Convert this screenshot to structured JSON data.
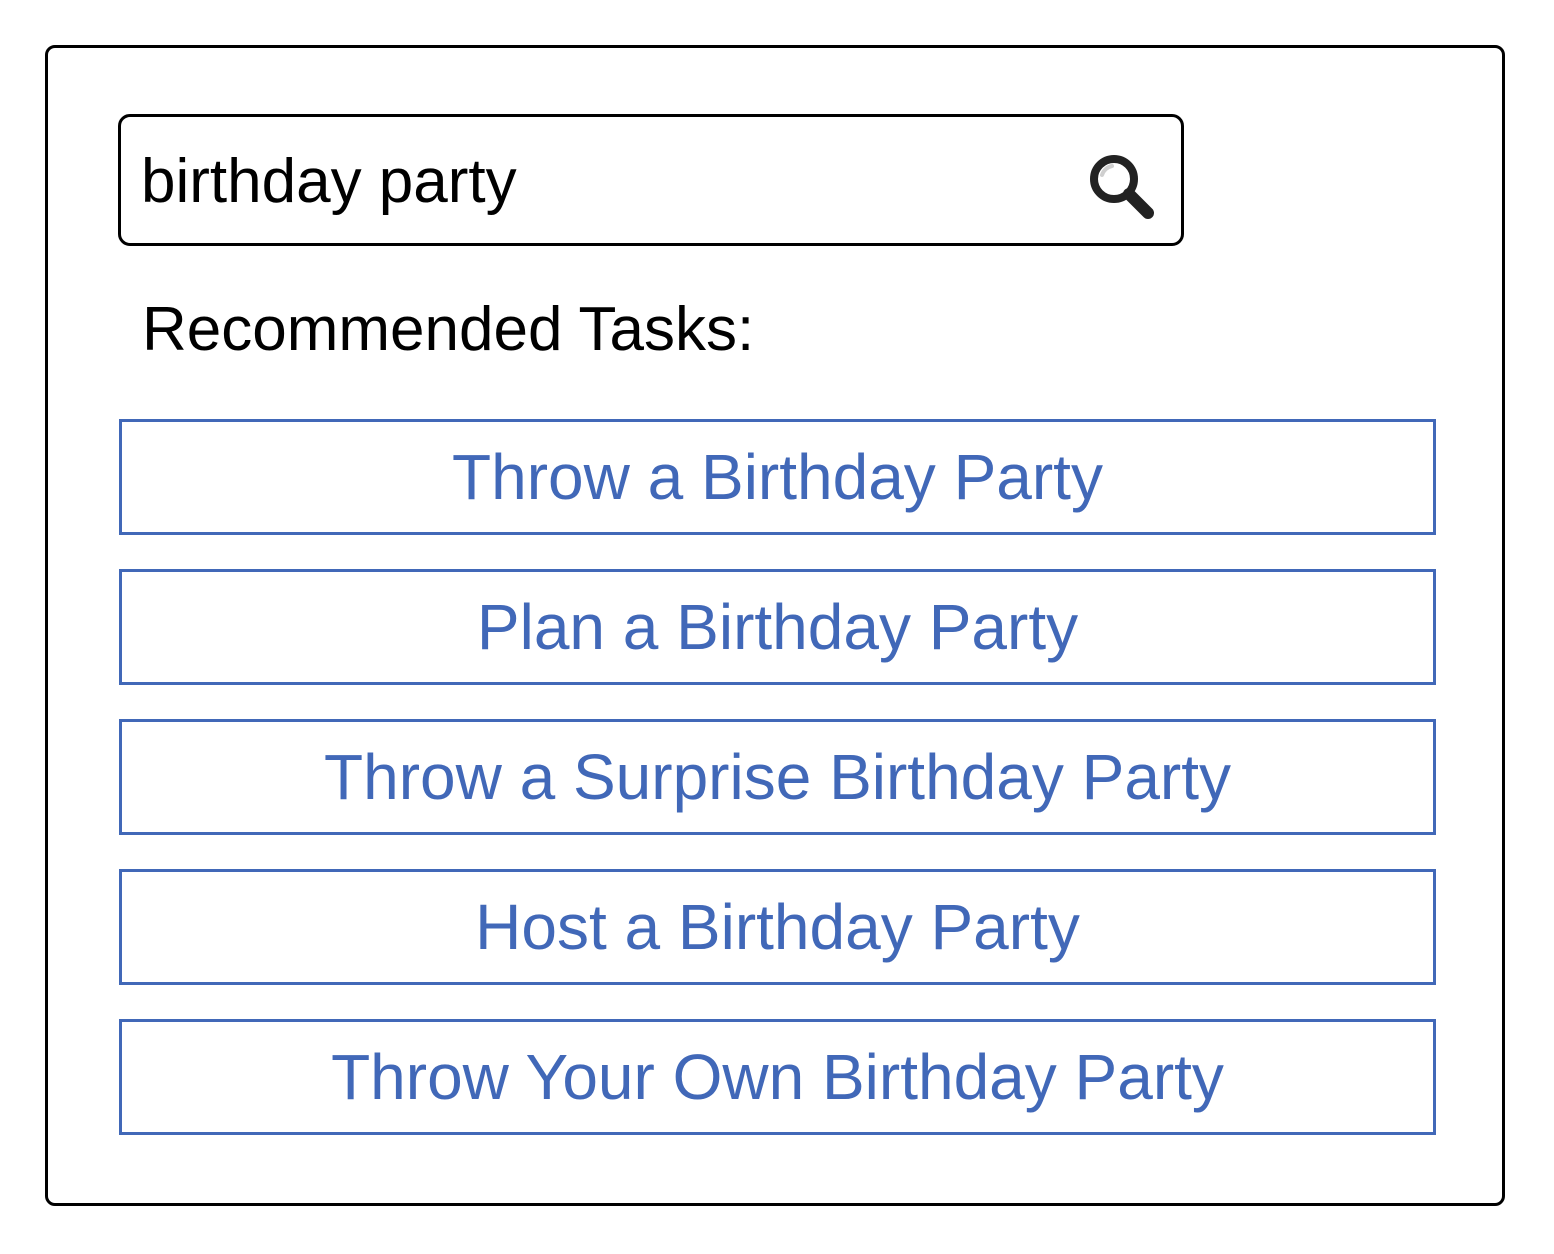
{
  "search": {
    "value": "birthday party",
    "icon": "magnifying-glass-icon"
  },
  "recommended": {
    "title": "Recommended Tasks:",
    "tasks": [
      "Throw a Birthday Party",
      "Plan a Birthday Party",
      "Throw a Surprise Birthday Party",
      "Host a Birthday Party",
      "Throw Your Own Birthday Party"
    ]
  },
  "colors": {
    "accent": "#4168b8",
    "border": "#000000",
    "background": "#ffffff"
  }
}
